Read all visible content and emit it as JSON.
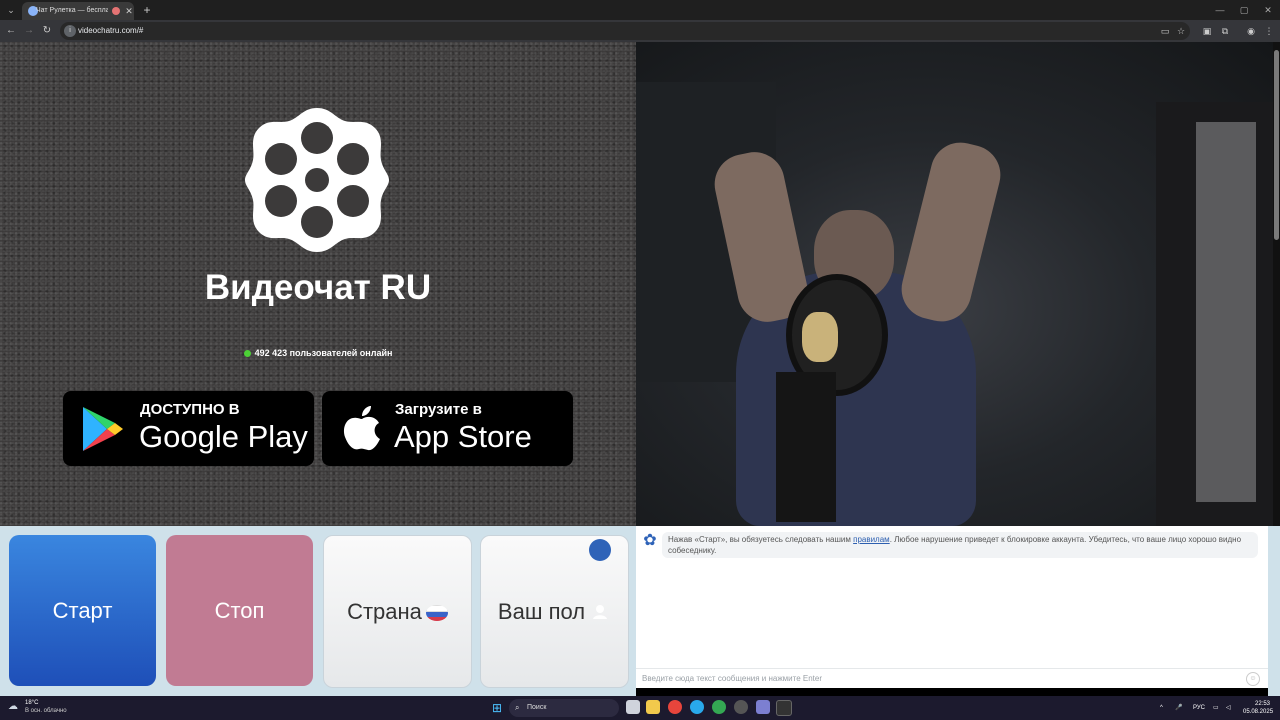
{
  "browser": {
    "tab_title": "Чат Рулетка — бесплатный",
    "url": "videochatru.com/#"
  },
  "left": {
    "brand": "Видеочат RU",
    "online_text": "492 423 пользователей онлайн",
    "google_play": {
      "small": "ДОСТУПНО В",
      "big": "Google Play"
    },
    "app_store": {
      "small": "Загрузите в",
      "big": "App Store"
    }
  },
  "controls": {
    "start": "Старт",
    "stop": "Стоп",
    "country": "Страна",
    "sex": "Ваш пол"
  },
  "chat": {
    "msg_before": "Нажав «Старт», вы обязуетесь следовать нашим ",
    "rules_link": "правилам",
    "msg_after": ". Любое нарушение приведет к блокировке аккаунта. Убедитесь, что ваше лицо хорошо видно собеседнику.",
    "input_placeholder": "Введите сюда текст сообщения и нажмите Enter"
  },
  "taskbar": {
    "temp": "18°C",
    "weather": "В осн. облачно",
    "search": "Поиск",
    "lang": "РУС",
    "time": "22:53",
    "date": "05.08.2025"
  },
  "colors": {
    "start": "#2a6ccf",
    "stop": "#c17b93",
    "online_dot": "#4cd136",
    "chat_bg": "#cfe1ea"
  }
}
